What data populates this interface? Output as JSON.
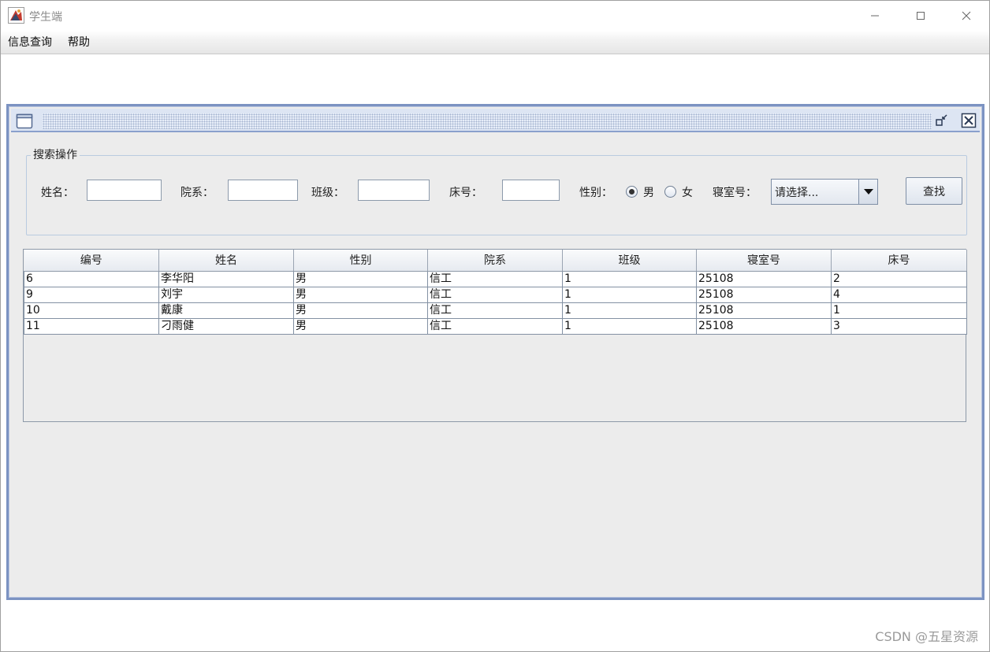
{
  "window": {
    "title": "学生端"
  },
  "menu": {
    "items": [
      {
        "label": "信息查询"
      },
      {
        "label": "帮助"
      }
    ]
  },
  "search": {
    "legend": "搜索操作",
    "name_label": "姓名：",
    "dept_label": "院系：",
    "class_label": "班级：",
    "bed_label": "床号：",
    "gender_label": "性别：",
    "gender_options": [
      {
        "label": "男",
        "checked": true
      },
      {
        "label": "女",
        "checked": false
      }
    ],
    "dorm_label": "寝室号：",
    "dorm_select": "请选择...",
    "find_button": "查找"
  },
  "table": {
    "columns": [
      "编号",
      "姓名",
      "性别",
      "院系",
      "班级",
      "寝室号",
      "床号"
    ],
    "rows": [
      [
        "6",
        "李华阳",
        "男",
        "信工",
        "1",
        "25108",
        "2"
      ],
      [
        "9",
        "刘宇",
        "男",
        "信工",
        "1",
        "25108",
        "4"
      ],
      [
        "10",
        "戴康",
        "男",
        "信工",
        "1",
        "25108",
        "1"
      ],
      [
        "11",
        "刁雨健",
        "男",
        "信工",
        "1",
        "25108",
        "3"
      ]
    ]
  },
  "watermark": "CSDN @五星资源"
}
